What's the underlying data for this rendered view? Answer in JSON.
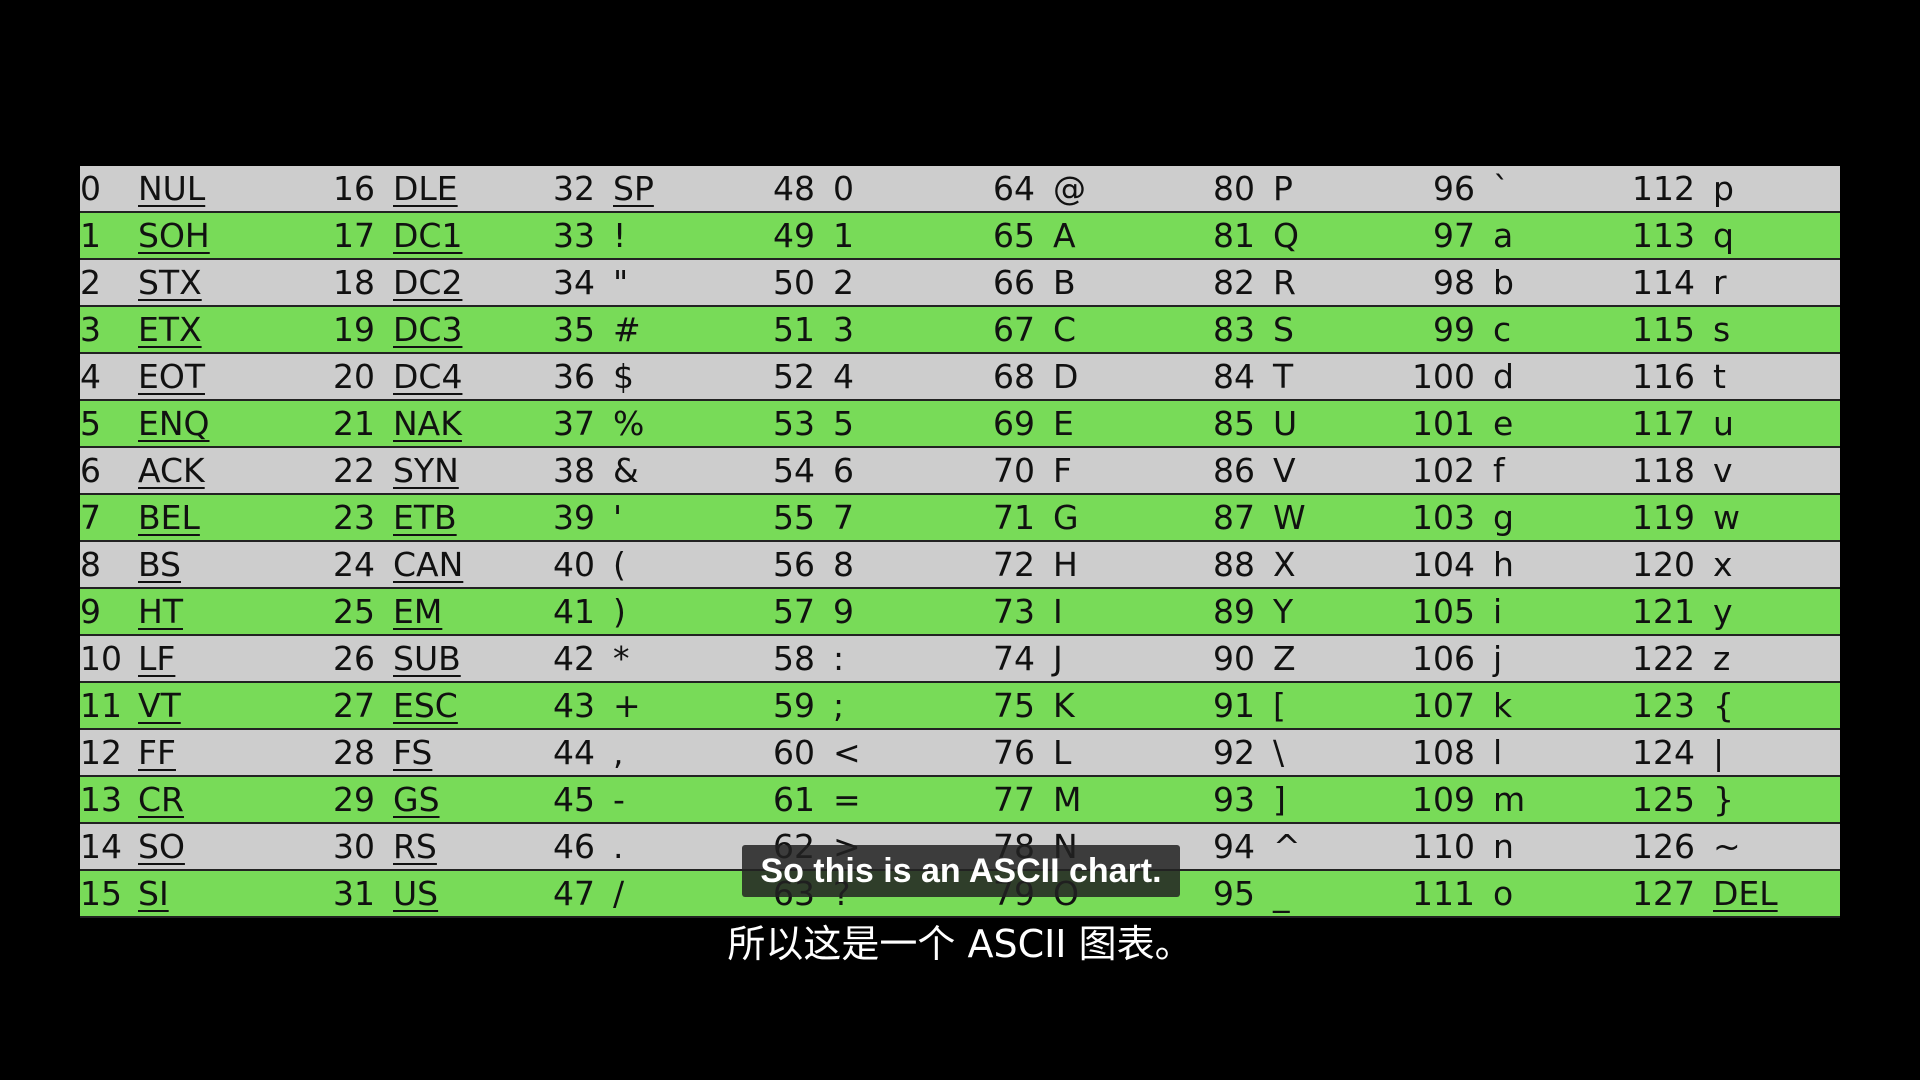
{
  "colors": {
    "background": "#000000",
    "row_gray": "#cdcdcd",
    "row_green": "#78db58",
    "text": "#111111",
    "subtitle_text": "#ffffff"
  },
  "ascii_table": {
    "row_pattern": [
      "gray",
      "green"
    ],
    "columns": [
      {
        "start": 0,
        "symbols": [
          "NUL",
          "SOH",
          "STX",
          "ETX",
          "EOT",
          "ENQ",
          "ACK",
          "BEL",
          "BS",
          "HT",
          "LF",
          "VT",
          "FF",
          "CR",
          "SO",
          "SI"
        ],
        "control": true
      },
      {
        "start": 16,
        "symbols": [
          "DLE",
          "DC1",
          "DC2",
          "DC3",
          "DC4",
          "NAK",
          "SYN",
          "ETB",
          "CAN",
          "EM",
          "SUB",
          "ESC",
          "FS",
          "GS",
          "RS",
          "US"
        ],
        "control": true
      },
      {
        "start": 32,
        "symbols": [
          "SP",
          "!",
          "\"",
          "#",
          "$",
          "%",
          "&",
          "'",
          "(",
          ")",
          "*",
          "+",
          ",",
          "-",
          ".",
          "/"
        ],
        "control": false
      },
      {
        "start": 48,
        "symbols": [
          "0",
          "1",
          "2",
          "3",
          "4",
          "5",
          "6",
          "7",
          "8",
          "9",
          ":",
          ";",
          "<",
          "=",
          ">",
          "?"
        ],
        "control": false
      },
      {
        "start": 64,
        "symbols": [
          "@",
          "A",
          "B",
          "C",
          "D",
          "E",
          "F",
          "G",
          "H",
          "I",
          "J",
          "K",
          "L",
          "M",
          "N",
          "O"
        ],
        "control": false
      },
      {
        "start": 80,
        "symbols": [
          "P",
          "Q",
          "R",
          "S",
          "T",
          "U",
          "V",
          "W",
          "X",
          "Y",
          "Z",
          "[",
          "\\",
          "]",
          "^",
          "_"
        ],
        "control": false
      },
      {
        "start": 96,
        "symbols": [
          "`",
          "a",
          "b",
          "c",
          "d",
          "e",
          "f",
          "g",
          "h",
          "i",
          "j",
          "k",
          "l",
          "m",
          "n",
          "o"
        ],
        "control": false
      },
      {
        "start": 112,
        "symbols": [
          "p",
          "q",
          "r",
          "s",
          "t",
          "u",
          "v",
          "w",
          "x",
          "y",
          "z",
          "{",
          "|",
          "}",
          "~",
          "DEL"
        ],
        "control": false
      }
    ],
    "underlined_printable": [
      "SP",
      "DEL"
    ]
  },
  "subtitles": {
    "english": "So this is an ASCII chart.",
    "chinese": "所以这是一个 ASCII 图表。"
  }
}
